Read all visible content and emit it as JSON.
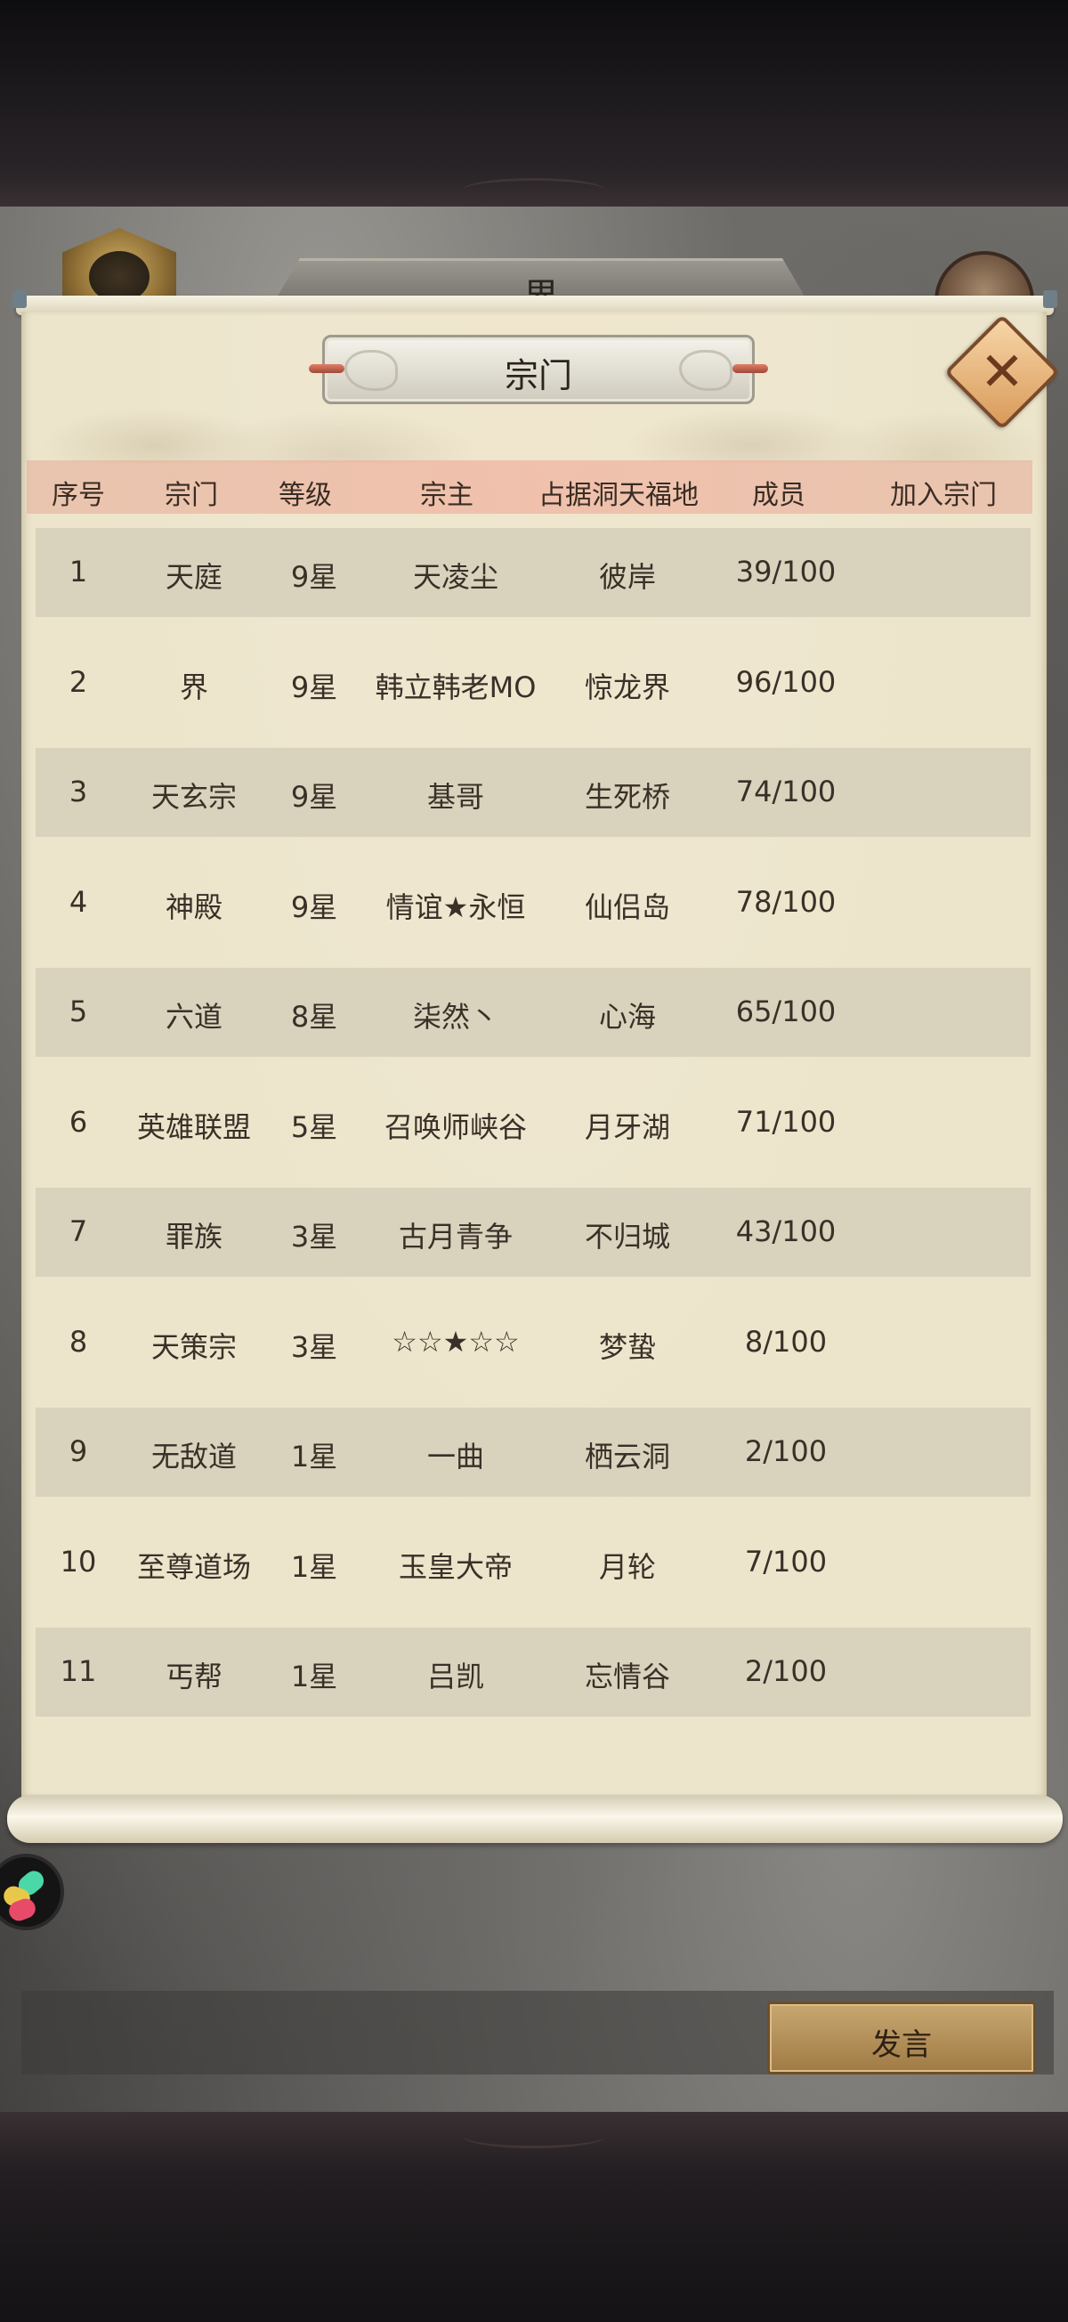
{
  "background": {
    "tab_label": "界"
  },
  "dialog": {
    "title": "宗门",
    "columns": [
      "序号",
      "宗门",
      "等级",
      "宗主",
      "占据洞天福地",
      "成员",
      "加入宗门"
    ],
    "rows": [
      {
        "no": "1",
        "sect": "天庭",
        "level": "9星",
        "leader": "天凌尘",
        "territory": "彼岸",
        "members": "39/100"
      },
      {
        "no": "2",
        "sect": "界",
        "level": "9星",
        "leader": "韩立韩老MO",
        "territory": "惊龙界",
        "members": "96/100"
      },
      {
        "no": "3",
        "sect": "天玄宗",
        "level": "9星",
        "leader": "基哥",
        "territory": "生死桥",
        "members": "74/100"
      },
      {
        "no": "4",
        "sect": "神殿",
        "level": "9星",
        "leader": "情谊★永恒",
        "territory": "仙侣岛",
        "members": "78/100"
      },
      {
        "no": "5",
        "sect": "六道",
        "level": "8星",
        "leader": "柒然丶",
        "territory": "心海",
        "members": "65/100"
      },
      {
        "no": "6",
        "sect": "英雄联盟",
        "level": "5星",
        "leader": "召唤师峡谷",
        "territory": "月牙湖",
        "members": "71/100"
      },
      {
        "no": "7",
        "sect": "罪族",
        "level": "3星",
        "leader": "古月青争",
        "territory": "不归城",
        "members": "43/100"
      },
      {
        "no": "8",
        "sect": "天策宗",
        "level": "3星",
        "leader": "☆☆★☆☆",
        "territory": "梦蛰",
        "members": "8/100"
      },
      {
        "no": "9",
        "sect": "无敌道",
        "level": "1星",
        "leader": "一曲",
        "territory": "栖云洞",
        "members": "2/100"
      },
      {
        "no": "10",
        "sect": "至尊道场",
        "level": "1星",
        "leader": "玉皇大帝",
        "territory": "月轮",
        "members": "7/100"
      },
      {
        "no": "11",
        "sect": "丐帮",
        "level": "1星",
        "leader": "吕凯",
        "territory": "忘情谷",
        "members": "2/100"
      }
    ]
  },
  "chat": {
    "speak_label": "发言"
  },
  "icons": {
    "close": "close-icon",
    "avatar": "game-avatar-icon",
    "badge": "sect-badge-icon",
    "back": "back-icon"
  }
}
